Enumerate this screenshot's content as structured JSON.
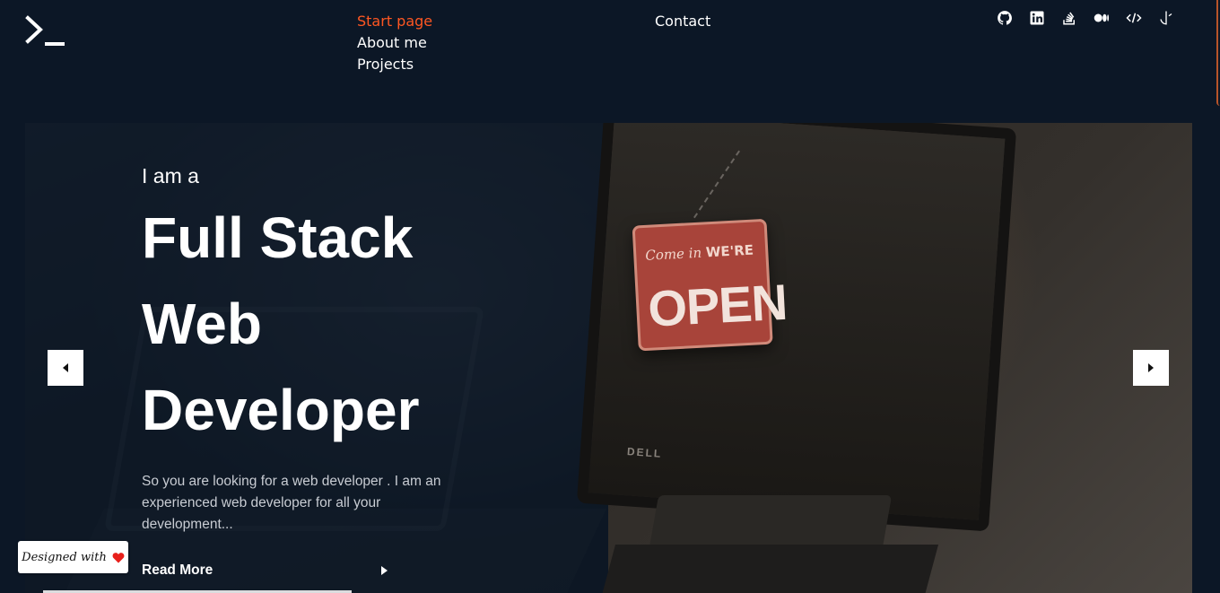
{
  "header": {
    "nav": {
      "start_page": "Start page",
      "about_me": "About me",
      "projects": "Projects",
      "contact": "Contact"
    },
    "social_icons": [
      "github-icon",
      "linkedin-icon",
      "stackoverflow-icon",
      "medium-icon",
      "code-icon",
      "unknown-app-icon"
    ]
  },
  "hero": {
    "pre_title": "I am a",
    "title_lines": [
      "Full Stack",
      "Web",
      "Developer"
    ],
    "description": "So you are looking for a web developer . I am an experienced web developer for all your development...",
    "read_more": "Read More",
    "image": {
      "sign_small": "Come in",
      "sign_small_bold": "WE'RE",
      "sign_big": "OPEN",
      "brand": "DELL"
    }
  },
  "badge": {
    "label": "Designed with"
  },
  "colors": {
    "background": "#0c1726",
    "accent": "#ff5722",
    "heart": "#e8201b"
  }
}
